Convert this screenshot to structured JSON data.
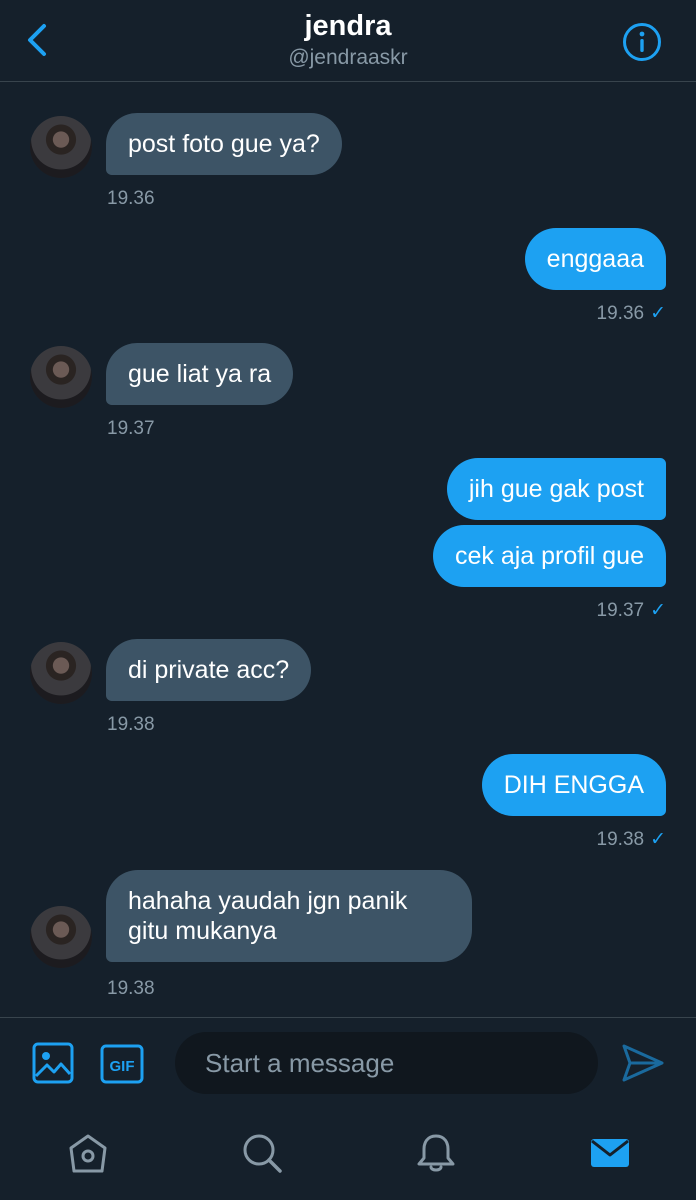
{
  "header": {
    "title": "jendra",
    "handle": "@jendraaskr",
    "back_icon": "chevron-left-icon",
    "info_icon": "info-icon"
  },
  "messages": [
    {
      "side": "in",
      "text": "post foto gue ya?",
      "time": "19.36"
    },
    {
      "side": "out",
      "text": "enggaaa",
      "time": "19.36",
      "status": "✓"
    },
    {
      "side": "in",
      "text": "gue liat ya ra",
      "time": "19.37"
    },
    {
      "side": "out",
      "text": "jih gue gak post"
    },
    {
      "side": "out",
      "text": "cek aja profil gue",
      "time": "19.37",
      "status": "✓"
    },
    {
      "side": "in",
      "text": "di private acc?",
      "time": "19.38"
    },
    {
      "side": "out",
      "text": "DIH ENGGA",
      "time": "19.38",
      "status": "✓"
    },
    {
      "side": "in",
      "text_line1": "hahaha yaudah jgn panik",
      "text_line2": "gitu mukanya",
      "time": "19.38"
    }
  ],
  "composer": {
    "placeholder": "Start a message",
    "gif_label": "GIF",
    "media_icon": "image-icon",
    "send_icon": "send-icon"
  },
  "tabbar": {
    "items": [
      "home-icon",
      "search-icon",
      "notifications-icon",
      "messages-icon"
    ],
    "active": "messages-icon"
  },
  "colors": {
    "background": "#15202b",
    "accent": "#1da1f2",
    "incoming_bubble": "#3d5466",
    "muted_text": "#8899a6",
    "divider": "#38444d"
  }
}
